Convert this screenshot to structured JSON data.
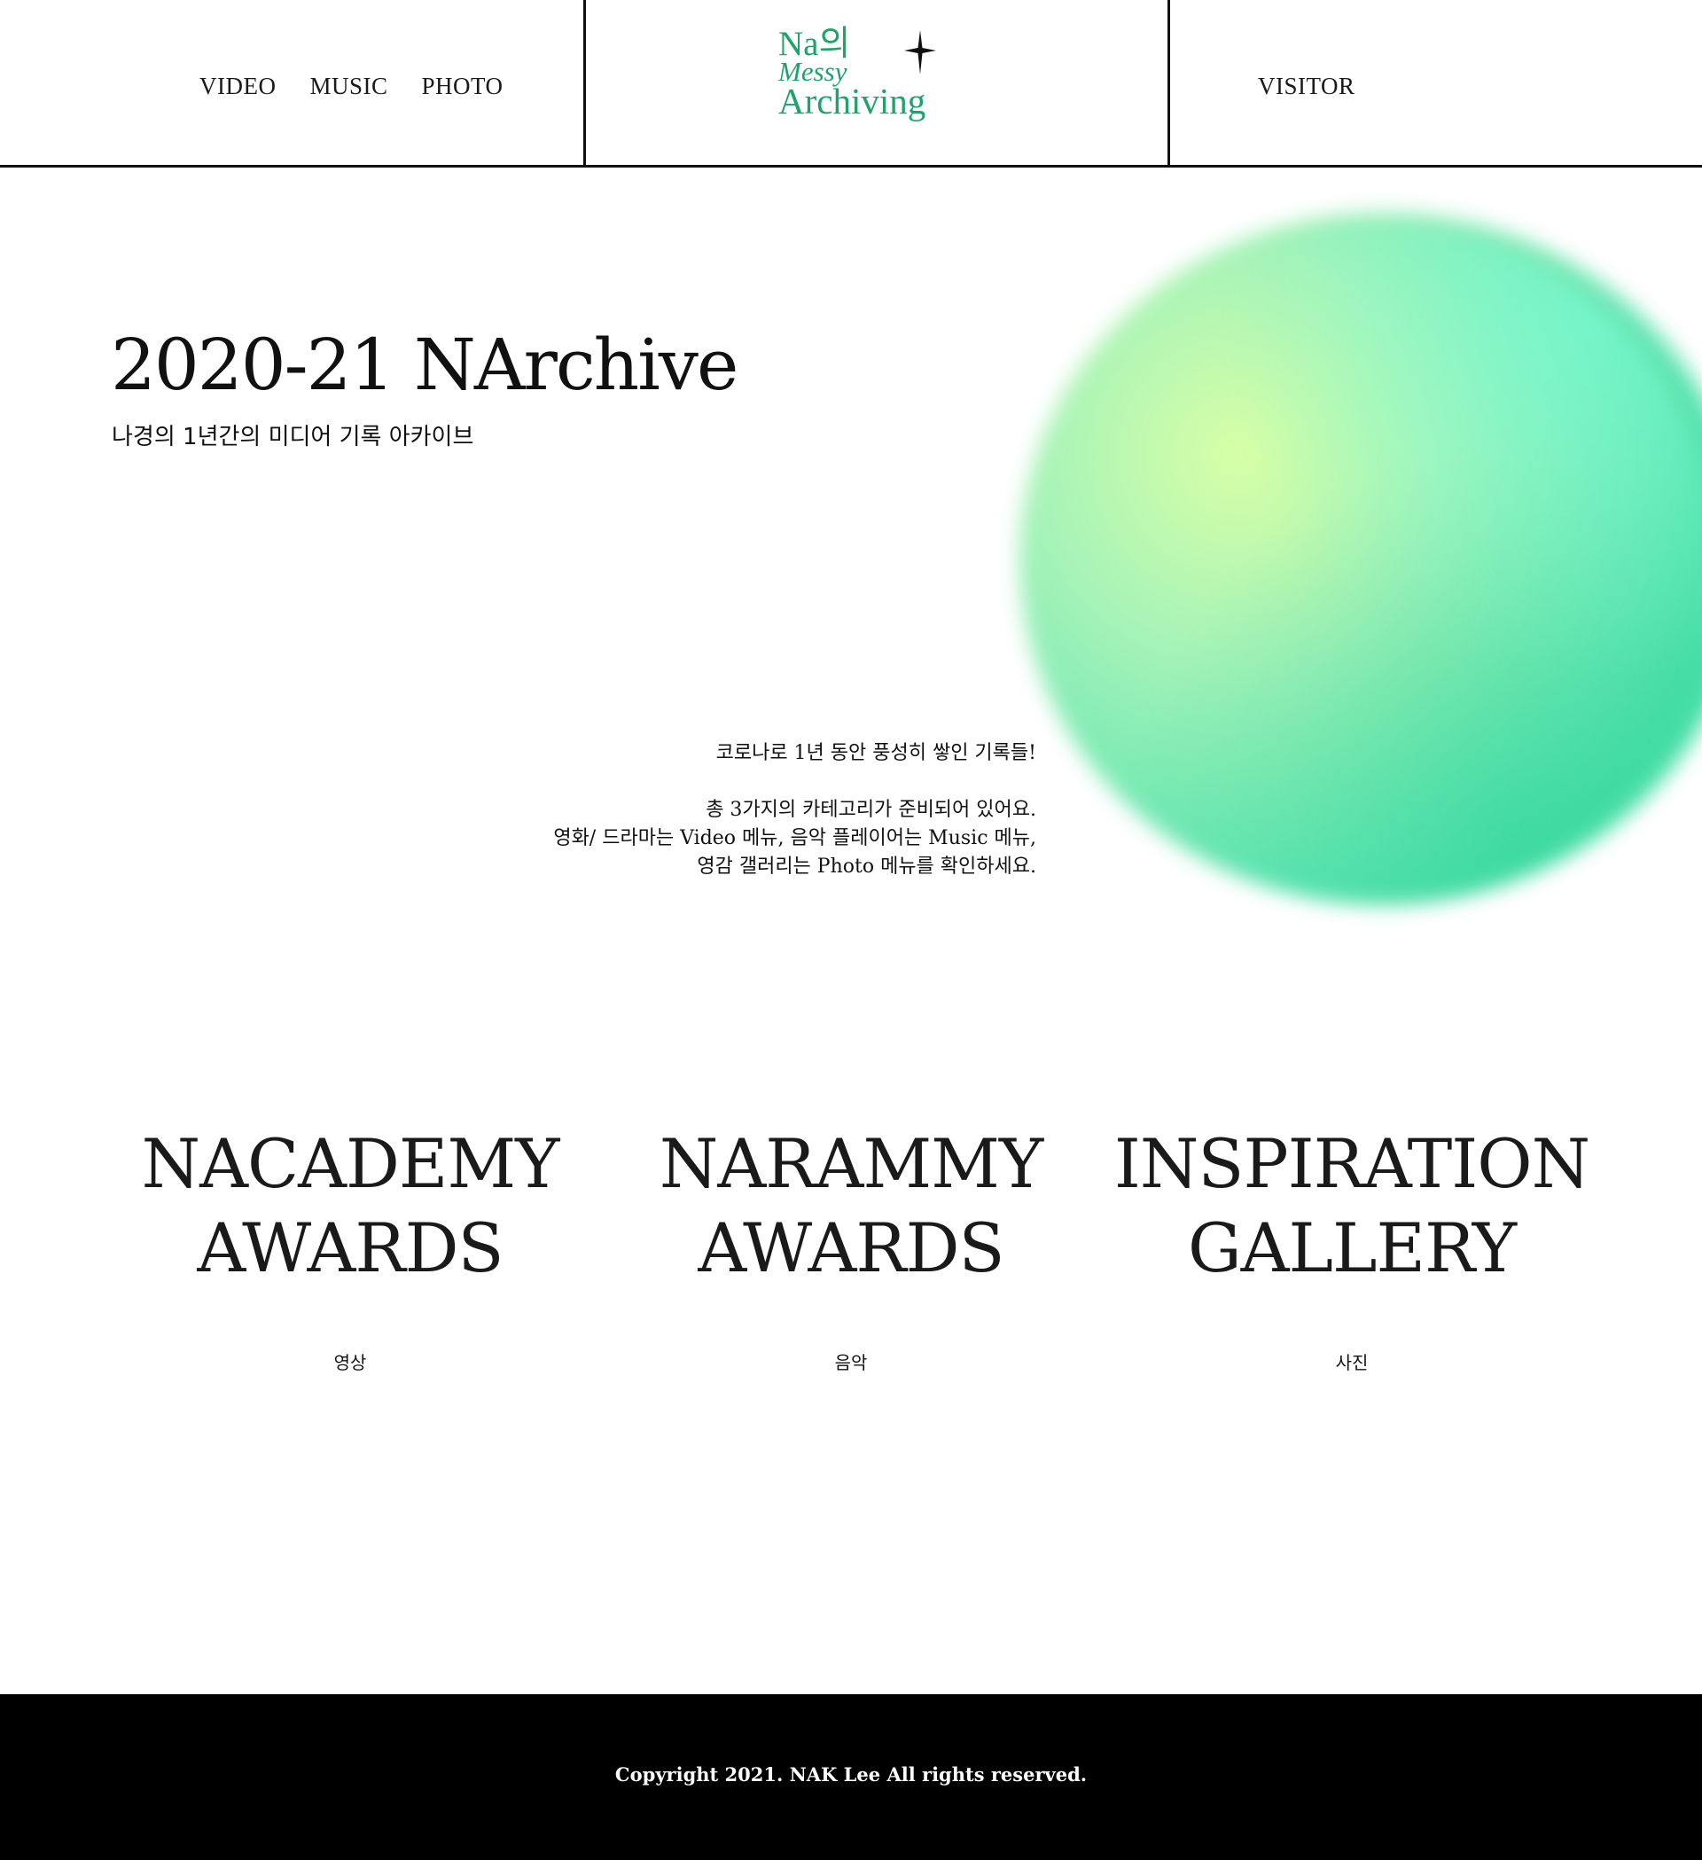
{
  "nav": {
    "left": [
      "VIDEO",
      "MUSIC",
      "PHOTO"
    ],
    "right": "VISITOR"
  },
  "logo": {
    "line1": "Na의",
    "line2": "Messy",
    "line3": "Archiving",
    "color": "#1fa36b",
    "icon": "sparkle-star-icon"
  },
  "hero": {
    "title": "2020-21 NArchive",
    "subtitle": "나경의 1년간의 미디어 기록 아카이브"
  },
  "intro": {
    "line1": "코로나로 1년 동안 풍성히 쌓인 기록들!",
    "line2": "총 3가지의 카테고리가 준비되어 있어요.",
    "line3": "영화/ 드라마는 Video 메뉴, 음악 플레이어는 Music 메뉴,",
    "line4": "영감 갤러리는 Photo 메뉴를 확인하세요."
  },
  "categories": [
    {
      "title1": "NACADEMY",
      "title2": "AWARDS",
      "label": "영상"
    },
    {
      "title1": "NARAMMY",
      "title2": "AWARDS",
      "label": "음악"
    },
    {
      "title1": "INSPIRATION",
      "title2": "GALLERY",
      "label": "사진"
    }
  ],
  "footer": {
    "copyright": "Copyright 2021. NAK Lee All rights reserved."
  },
  "colors": {
    "accent": "#1fa36b",
    "blob_light": "#d8ffa6",
    "blob_dark": "#3fdca4",
    "footer_bg": "#000000"
  }
}
